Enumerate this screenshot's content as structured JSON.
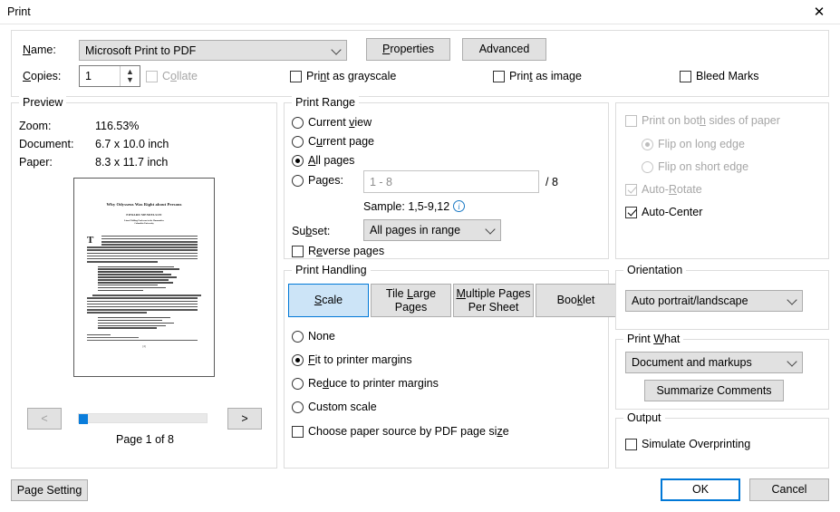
{
  "window": {
    "title": "Print",
    "close_icon": "close-icon"
  },
  "printer": {
    "name_label": "Name:",
    "name_value": "Microsoft Print to PDF",
    "copies_label": "Copies:",
    "copies_value": "1",
    "collate_label": "Collate",
    "properties_button": "Properties",
    "advanced_button": "Advanced",
    "print_as_grayscale_label": "Print as grayscale",
    "print_as_image_label": "Print as image",
    "bleed_marks_label": "Bleed Marks"
  },
  "preview": {
    "legend": "Preview",
    "zoom_label": "Zoom:",
    "zoom_value": "116.53%",
    "document_label": "Document:",
    "document_value": "6.7 x 10.0 inch",
    "paper_label": "Paper:",
    "paper_value": "8.3 x 11.7 inch",
    "prev_button": "<",
    "next_button": ">",
    "page_status": "Page 1 of 8",
    "document_page": {
      "title": "Why Odysseus Was Right about Persons",
      "author": "EDWARD MENDELSON",
      "affiliation_line1": "Lionel Trilling Professor in the Humanities",
      "affiliation_line2": "Columbia University",
      "drop_cap": "T",
      "page_number": "[4]"
    }
  },
  "print_range": {
    "legend": "Print Range",
    "current_view_label": "Current view",
    "current_page_label": "Current page",
    "all_pages_label": "All pages",
    "pages_label": "Pages:",
    "pages_placeholder": "1 - 8",
    "page_total": "/ 8",
    "sample_text": "Sample: 1,5-9,12",
    "info_icon": "info-icon",
    "subset_label": "Subset:",
    "subset_value": "All pages in range",
    "reverse_pages_label": "Reverse pages",
    "selected": "all_pages"
  },
  "print_handling": {
    "legend": "Print Handling",
    "tabs": [
      {
        "line1": "Scale",
        "line2": ""
      },
      {
        "line1": "Tile Large",
        "line2": "Pages"
      },
      {
        "line1": "Multiple Pages",
        "line2": "Per Sheet"
      },
      {
        "line1": "Booklet",
        "line2": ""
      }
    ],
    "active_tab": "Scale",
    "none_label": "None",
    "fit_label": "Fit to printer margins",
    "reduce_label": "Reduce to printer margins",
    "custom_label": "Custom scale",
    "paper_source_label": "Choose paper source by PDF page size",
    "selected": "fit"
  },
  "duplex": {
    "both_sides_label": "Print on both sides of paper",
    "flip_long_label": "Flip on long edge",
    "flip_short_label": "Flip on short edge",
    "auto_rotate_label": "Auto-Rotate",
    "auto_center_label": "Auto-Center"
  },
  "orientation": {
    "legend": "Orientation",
    "value": "Auto portrait/landscape"
  },
  "print_what": {
    "legend": "Print What",
    "value": "Document and markups",
    "summarize_button": "Summarize Comments"
  },
  "output": {
    "legend": "Output",
    "simulate_overprinting_label": "Simulate Overprinting"
  },
  "footer": {
    "page_setting_button": "Page Setting",
    "ok_button": "OK",
    "cancel_button": "Cancel"
  },
  "colors": {
    "accent": "#0078d7",
    "active_tab_fill": "#cce4f7",
    "scroll_thumb": "#0a7ddb",
    "info_blue": "#1a79c4"
  }
}
